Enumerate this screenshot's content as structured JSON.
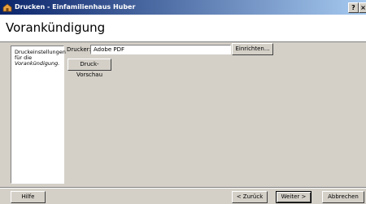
{
  "window": {
    "title": "Drucken - Einfamilienhaus Huber",
    "help_button": "?",
    "close_button": "×"
  },
  "page": {
    "heading": "Vorankündigung"
  },
  "sidebar": {
    "line1": "Druckeinstellungen",
    "line2": "für die",
    "line3": "Vorankündigung."
  },
  "printer": {
    "label": "Drucker:",
    "value": "Adobe PDF",
    "settings_button": "Einrichten...",
    "preview_button": "Druck-Vorschau"
  },
  "footer": {
    "help": "Hilfe",
    "back": "< Zurück",
    "next": "Weiter >",
    "cancel": "Abbrechen"
  },
  "colors": {
    "title_start": "#0a246a",
    "title_end": "#a6caf0",
    "face": "#d4d0c8"
  }
}
